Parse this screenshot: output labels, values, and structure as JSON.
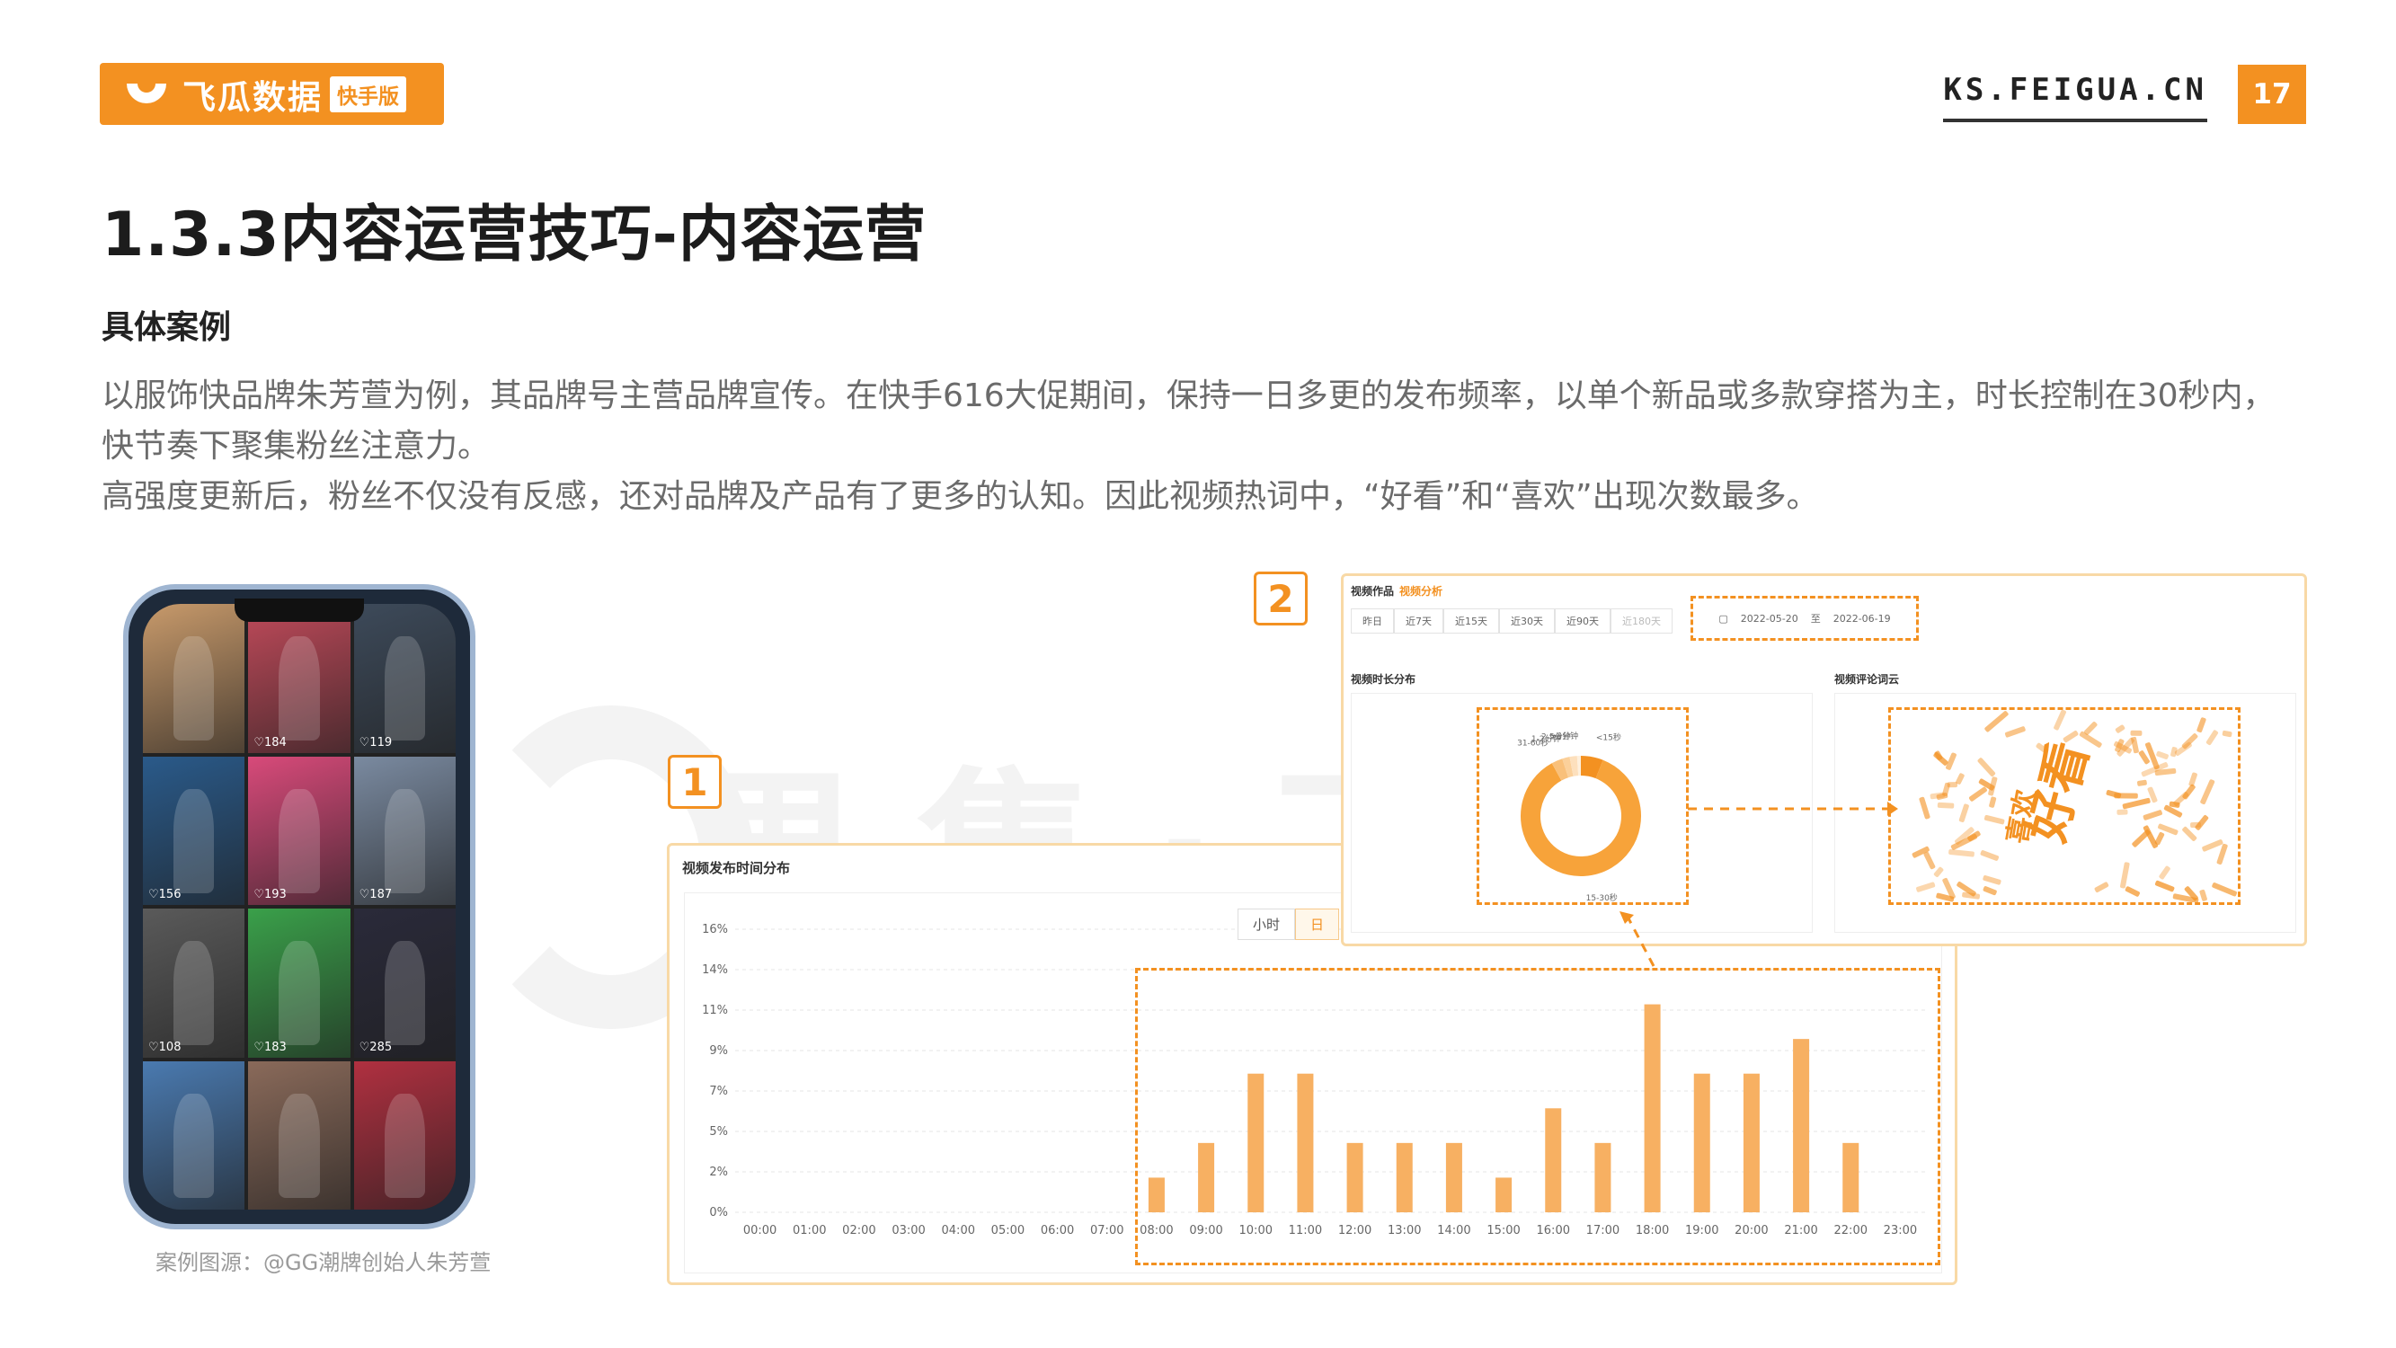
{
  "header": {
    "logo_name": "飞瓜数据",
    "logo_tag": "快手版",
    "site": "KS.FEIGUA.CN",
    "page_number": "17"
  },
  "title": "1.3.3内容运营技巧-内容运营",
  "subtitle": "具体案例",
  "paragraphs": [
    "以服饰快品牌朱芳萱为例，其品牌号主营品牌宣传。在快手616大促期间，保持一日多更的发布频率，以单个新品或多款穿搭为主，时长控制在30秒内，快节奏下聚集粉丝注意力。",
    "高强度更新后，粉丝不仅没有反感，还对品牌及产品有了更多的认知。因此视频热词中，“好看”和“喜欢”出现次数最多。"
  ],
  "watermark": "果集·飞瓜 快手",
  "caption": "案例图源：@GG潮牌创始人朱芳萱",
  "phone": {
    "like_counts": [
      "",
      "184",
      "119",
      "156",
      "193",
      "187",
      "108",
      "183",
      "285",
      "",
      "",
      ""
    ]
  },
  "badges": [
    "1",
    "2"
  ],
  "panel1": {
    "title": "视频发布时间分布",
    "toggle": [
      "小时",
      "日"
    ]
  },
  "panel2": {
    "tab_main": "视频作品",
    "tab_active": "视频分析",
    "range_tabs": [
      "昨日",
      "近7天",
      "近15天",
      "近30天",
      "近90天",
      "近180天"
    ],
    "date_from": "2022-05-20",
    "date_sep": "至",
    "date_to": "2022-06-19",
    "left_title": "视频时长分布",
    "right_title": "视频评论词云",
    "cloud_big": "好看",
    "cloud_mid": "喜欢"
  },
  "chart_data": [
    {
      "type": "bar",
      "title": "视频发布时间分布",
      "categories": [
        "00:00",
        "01:00",
        "02:00",
        "03:00",
        "04:00",
        "05:00",
        "06:00",
        "07:00",
        "08:00",
        "09:00",
        "10:00",
        "11:00",
        "12:00",
        "13:00",
        "14:00",
        "15:00",
        "16:00",
        "17:00",
        "18:00",
        "19:00",
        "20:00",
        "21:00",
        "22:00",
        "23:00"
      ],
      "values": [
        0,
        0,
        0,
        0,
        0,
        0,
        0,
        0,
        2,
        4,
        8,
        8,
        4,
        4,
        4,
        2,
        6,
        4,
        12,
        8,
        8,
        10,
        4,
        0
      ],
      "ytick_labels": [
        "0%",
        "2%",
        "5%",
        "7%",
        "9%",
        "11%",
        "14%",
        "16%"
      ],
      "ylim": [
        0,
        14
      ],
      "grid": true,
      "color": "#f7b062"
    },
    {
      "type": "pie",
      "title": "视频时长分布",
      "labels": [
        "<15秒",
        "15-30秒",
        "31-60秒",
        "1-2分钟",
        "2-5分钟",
        ">5分钟"
      ],
      "values": [
        6,
        86,
        3,
        2,
        2,
        1
      ],
      "colors": [
        "#f39121",
        "#f7a33a",
        "#f9c07a",
        "#fbd09a",
        "#fde0bd",
        "#fef0dd"
      ]
    }
  ],
  "colors": {
    "accent": "#f39121",
    "bar": "#f7b062",
    "text": "#333333",
    "muted": "#6b6b6b"
  }
}
